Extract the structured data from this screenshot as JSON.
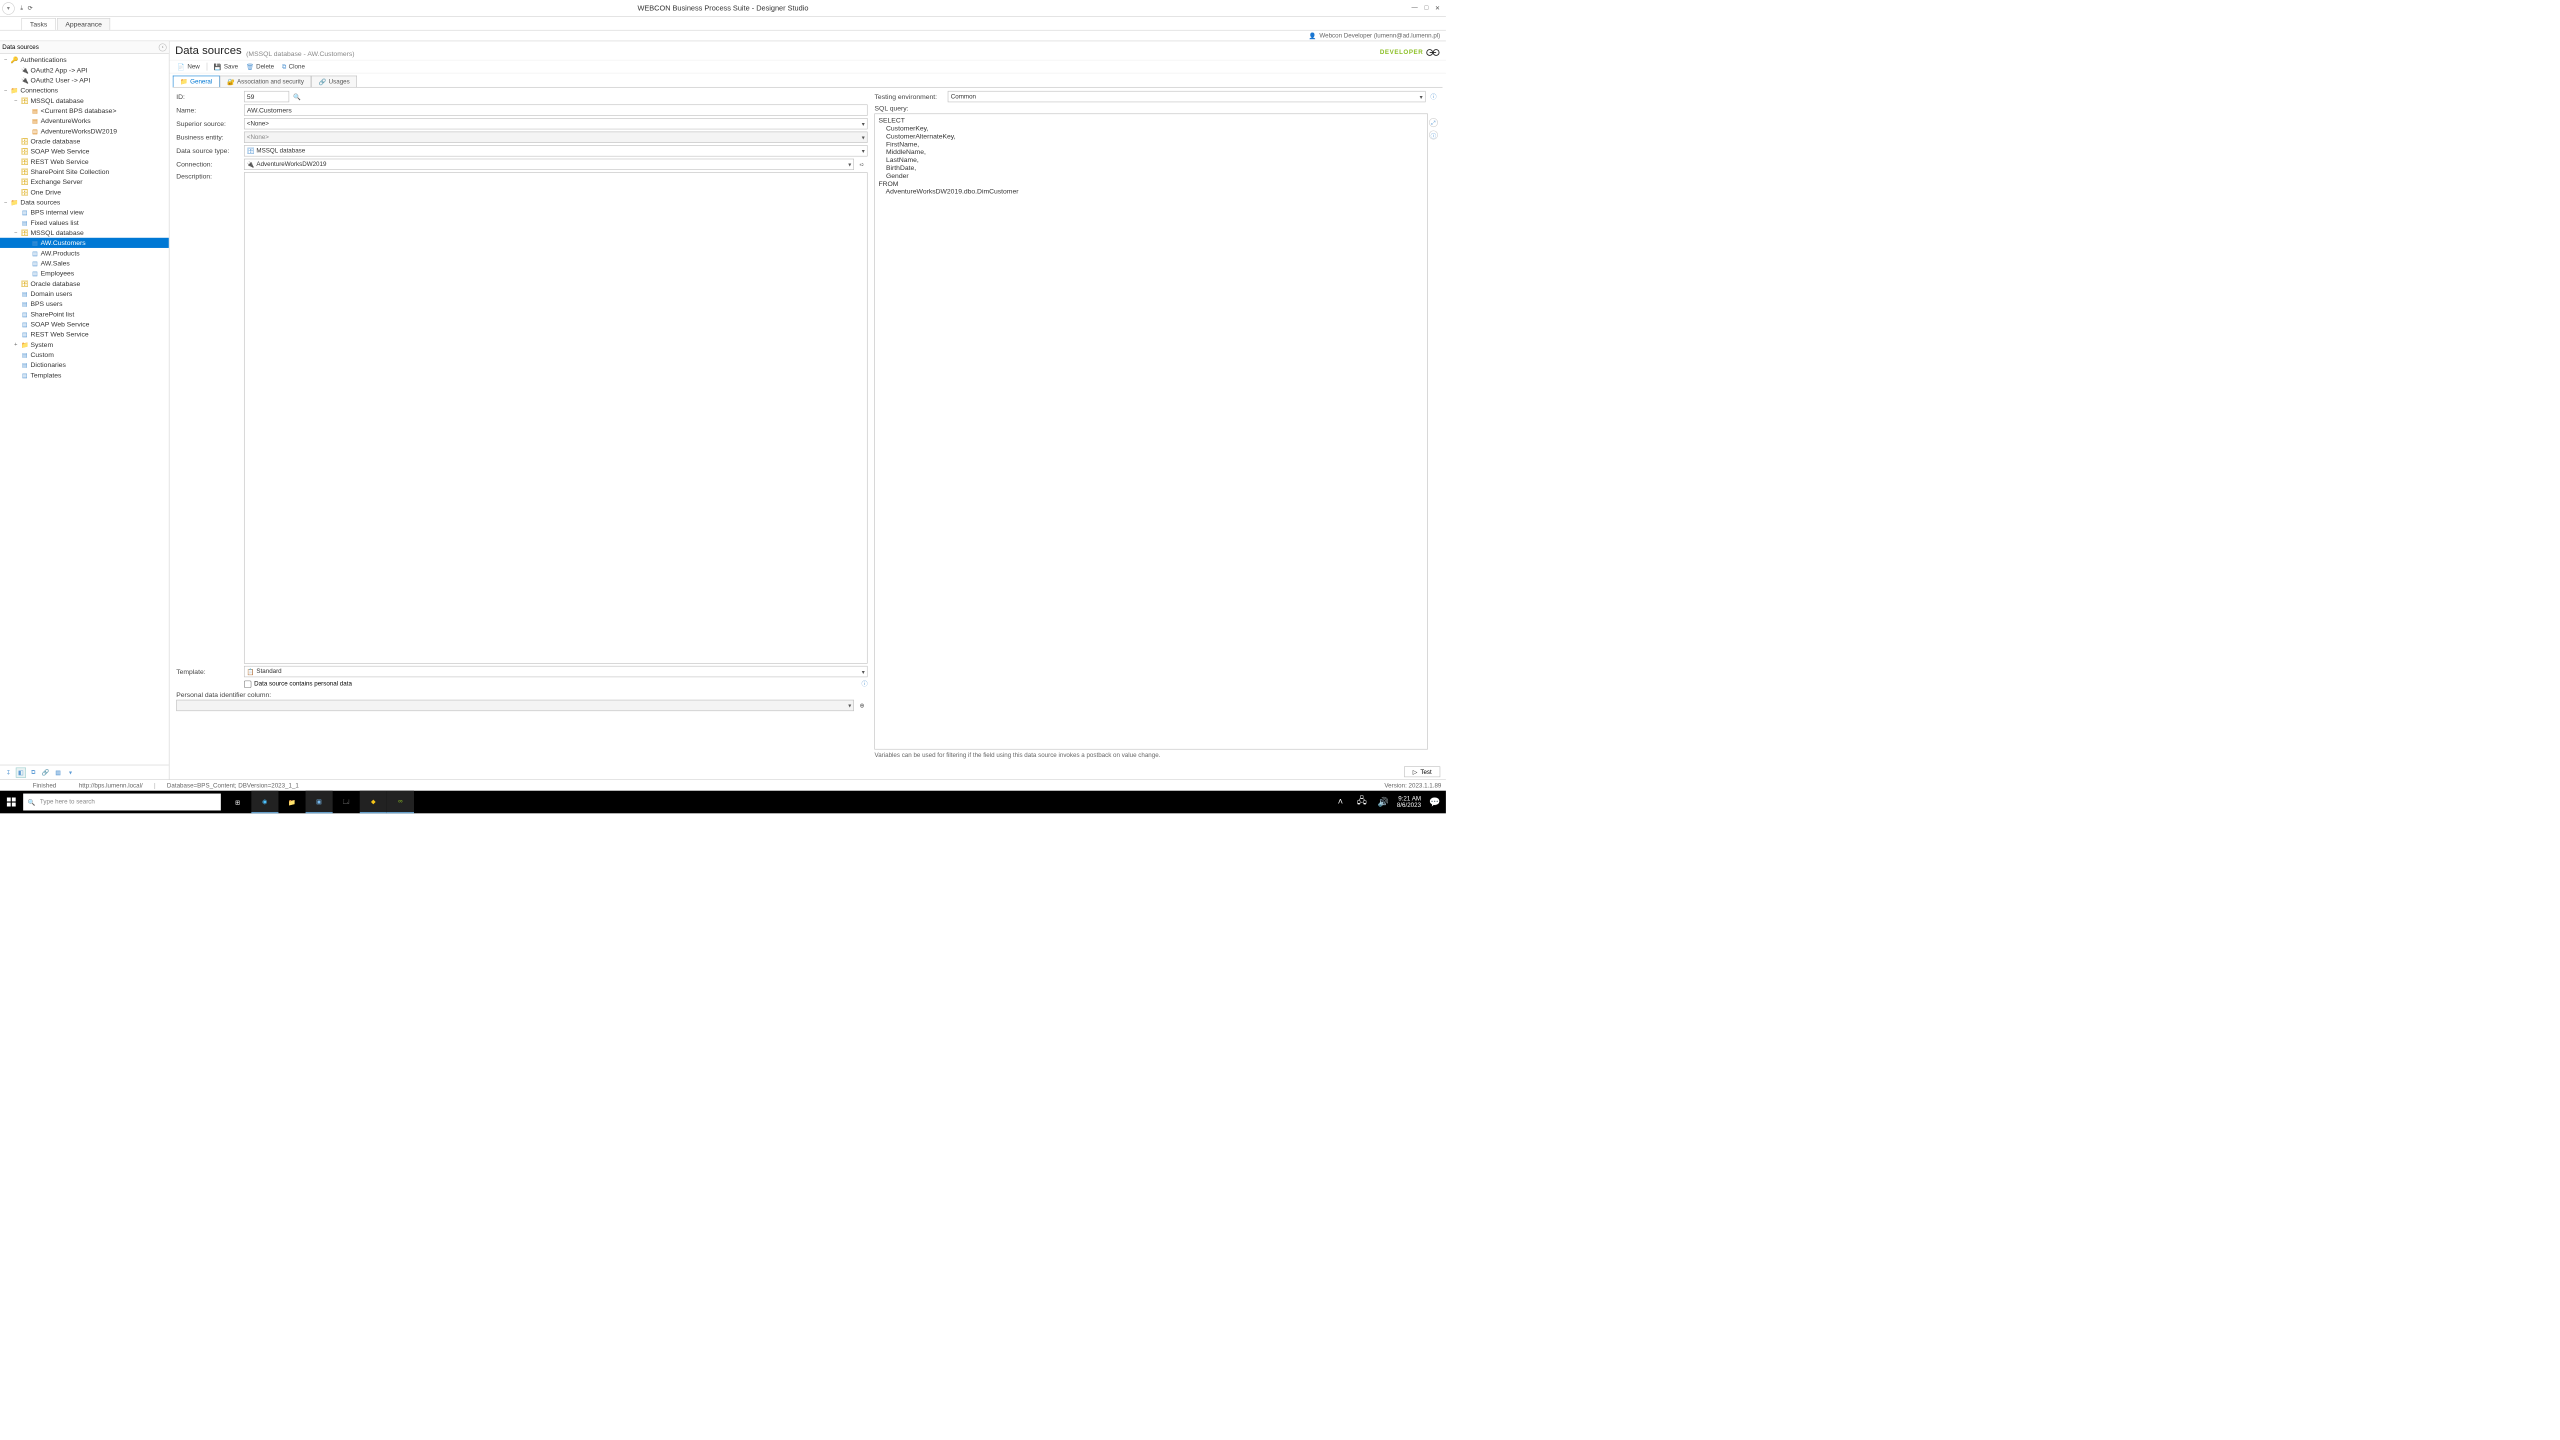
{
  "title": "WEBCON Business Process Suite - Designer Studio",
  "user": "Webcon Developer (lumenn@ad.lumenn.pl)",
  "ribbon": {
    "tabs": [
      "Tasks",
      "Appearance"
    ],
    "activeIndex": 0
  },
  "leftPanel": {
    "title": "Data sources",
    "toolbarIcons": [
      "sort-icon",
      "highlight-icon",
      "copy-icon",
      "link-icon",
      "grid-icon",
      "more-icon"
    ]
  },
  "tree": [
    {
      "d": 0,
      "exp": "−",
      "ic": "key",
      "label": "Authentications",
      "sel": false
    },
    {
      "d": 1,
      "exp": "",
      "ic": "conn",
      "label": "OAuth2 App -> API",
      "sel": false
    },
    {
      "d": 1,
      "exp": "",
      "ic": "conn",
      "label": "OAuth2 User -> API",
      "sel": false
    },
    {
      "d": 0,
      "exp": "−",
      "ic": "folder",
      "label": "Connections",
      "sel": false
    },
    {
      "d": 1,
      "exp": "−",
      "ic": "db",
      "label": "MSSQL database",
      "sel": false
    },
    {
      "d": 2,
      "exp": "",
      "ic": "leaf-o",
      "label": "<Current BPS database>",
      "sel": false
    },
    {
      "d": 2,
      "exp": "",
      "ic": "leaf-o",
      "label": "AdventureWorks",
      "sel": false
    },
    {
      "d": 2,
      "exp": "",
      "ic": "leaf-o",
      "label": "AdventureWorksDW2019",
      "sel": false
    },
    {
      "d": 1,
      "exp": "",
      "ic": "db",
      "label": "Oracle database",
      "sel": false
    },
    {
      "d": 1,
      "exp": "",
      "ic": "db",
      "label": "SOAP Web Service",
      "sel": false
    },
    {
      "d": 1,
      "exp": "",
      "ic": "db",
      "label": "REST Web Service",
      "sel": false
    },
    {
      "d": 1,
      "exp": "",
      "ic": "db",
      "label": "SharePoint Site Collection",
      "sel": false
    },
    {
      "d": 1,
      "exp": "",
      "ic": "db",
      "label": "Exchange Server",
      "sel": false
    },
    {
      "d": 1,
      "exp": "",
      "ic": "db",
      "label": "One Drive",
      "sel": false
    },
    {
      "d": 0,
      "exp": "−",
      "ic": "folder",
      "label": "Data sources",
      "sel": false
    },
    {
      "d": 1,
      "exp": "",
      "ic": "leaf",
      "label": "BPS internal view",
      "sel": false
    },
    {
      "d": 1,
      "exp": "",
      "ic": "leaf",
      "label": "Fixed values list",
      "sel": false
    },
    {
      "d": 1,
      "exp": "−",
      "ic": "db",
      "label": "MSSQL database",
      "sel": false
    },
    {
      "d": 2,
      "exp": "",
      "ic": "leaf",
      "label": "AW.Customers",
      "sel": true
    },
    {
      "d": 2,
      "exp": "",
      "ic": "leaf",
      "label": "AW.Products",
      "sel": false
    },
    {
      "d": 2,
      "exp": "",
      "ic": "leaf",
      "label": "AW.Sales",
      "sel": false
    },
    {
      "d": 2,
      "exp": "",
      "ic": "leaf",
      "label": "Employees",
      "sel": false
    },
    {
      "d": 1,
      "exp": "",
      "ic": "db",
      "label": "Oracle database",
      "sel": false
    },
    {
      "d": 1,
      "exp": "",
      "ic": "leaf",
      "label": "Domain users",
      "sel": false
    },
    {
      "d": 1,
      "exp": "",
      "ic": "leaf",
      "label": "BPS users",
      "sel": false
    },
    {
      "d": 1,
      "exp": "",
      "ic": "leaf",
      "label": "SharePoint list",
      "sel": false
    },
    {
      "d": 1,
      "exp": "",
      "ic": "leaf",
      "label": "SOAP Web Service",
      "sel": false
    },
    {
      "d": 1,
      "exp": "",
      "ic": "leaf",
      "label": "REST Web Service",
      "sel": false
    },
    {
      "d": 1,
      "exp": "+",
      "ic": "folder",
      "label": "System",
      "sel": false
    },
    {
      "d": 1,
      "exp": "",
      "ic": "leaf",
      "label": "Custom",
      "sel": false
    },
    {
      "d": 1,
      "exp": "",
      "ic": "leaf",
      "label": "Dictionaries",
      "sel": false
    },
    {
      "d": 1,
      "exp": "",
      "ic": "leaf",
      "label": "Templates",
      "sel": false
    }
  ],
  "page": {
    "heading": "Data sources",
    "subheading": "(MSSQL database - AW.Customers)",
    "brand": "DEVELOPER"
  },
  "actions": {
    "new": "New",
    "save": "Save",
    "delete": "Delete",
    "clone": "Clone"
  },
  "formTabs": [
    "General",
    "Association and security",
    "Usages"
  ],
  "form": {
    "id_label": "ID:",
    "id_value": "59",
    "name_label": "Name:",
    "name_value": "AW.Customers",
    "superior_label": "Superior source:",
    "superior_value": "<None>",
    "be_label": "Business entity:",
    "be_value": "<None>",
    "type_label": "Data source type:",
    "type_value": "MSSQL database",
    "conn_label": "Connection:",
    "conn_value": "AdventureWorksDW2019",
    "desc_label": "Description:",
    "template_label": "Template:",
    "template_value": "Standard",
    "personal_label": "Data source contains personal data",
    "idcol_label": "Personal data identifier column:"
  },
  "right": {
    "env_label": "Testing environment:",
    "env_value": "Common",
    "sql_label": "SQL query:",
    "sql_text": "SELECT\n    CustomerKey,\n    CustomerAlternateKey,\n    FirstName,\n    MiddleName,\n    LastName,\n    BirthDate,\n    Gender\nFROM\n    AdventureWorksDW2019.dbo.DimCustomer",
    "hint": "Variables can be used for filtering if the field using this data source invokes a postback on value change.",
    "test": "Test"
  },
  "status": {
    "state": "Finished",
    "url": "http://bps.lumenn.local/",
    "db": "Database=BPS_Content; DBVersion=2023_1_1",
    "version": "Version: 2023.1.1.89"
  },
  "taskbar": {
    "search_placeholder": "Type here to search",
    "time": "9:21 AM",
    "date": "8/6/2023"
  },
  "colors": {
    "accent": "#0078d4",
    "brand": "#8cbf26"
  }
}
